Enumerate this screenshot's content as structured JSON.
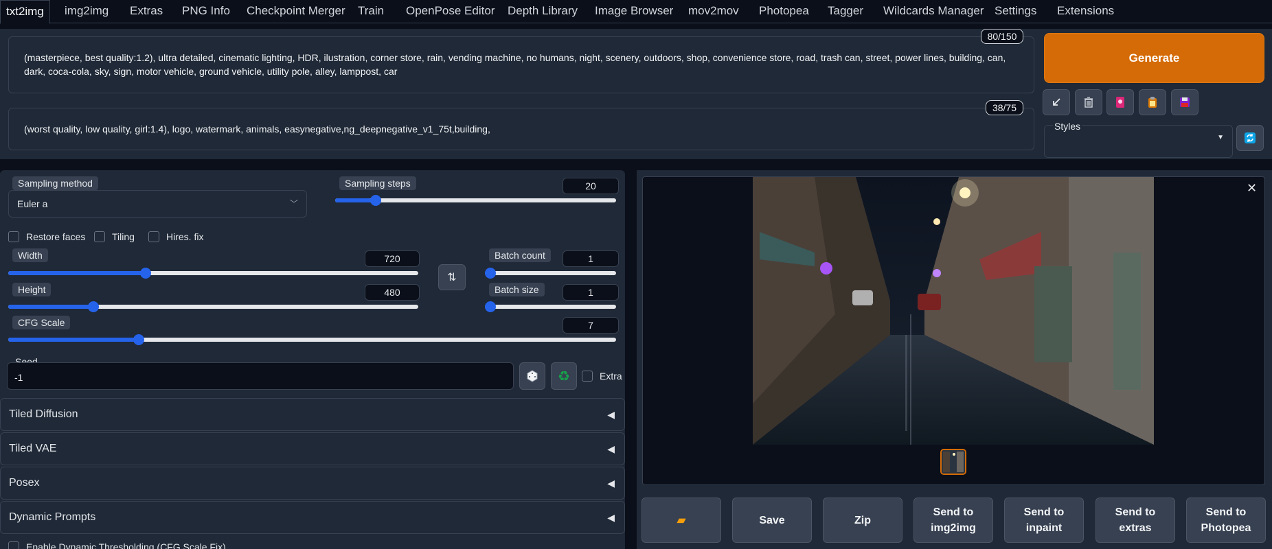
{
  "tabs": [
    "txt2img",
    "img2img",
    "Extras",
    "PNG Info",
    "Checkpoint Merger",
    "Train",
    "OpenPose Editor",
    "Depth Library",
    "Image Browser",
    "mov2mov",
    "Photopea",
    "Tagger",
    "Wildcards Manager",
    "Settings",
    "Extensions"
  ],
  "prompt": {
    "text": "(masterpiece, best quality:1.2), ultra detailed, cinematic lighting, HDR, ilustration, corner store, rain, vending machine, no humans, night, scenery, outdoors, shop, convenience store, road, trash can, street, power lines, building, can, dark, coca-cola, sky, sign, motor vehicle, ground vehicle, utility pole, alley, lamppost, car",
    "counter": "80/150"
  },
  "negative_prompt": {
    "text": "(worst quality, low quality, girl:1.4), logo, watermark, animals, easynegative,ng_deepnegative_v1_75t,building,",
    "counter": "38/75"
  },
  "generate_label": "Generate",
  "styles_label": "Styles",
  "sampling_method": {
    "label": "Sampling method",
    "value": "Euler a"
  },
  "sampling_steps": {
    "label": "Sampling steps",
    "value": "20",
    "fraction": 0.13
  },
  "checkboxes": {
    "restore_faces": "Restore faces",
    "tiling": "Tiling",
    "hires_fix": "Hires. fix"
  },
  "width": {
    "label": "Width",
    "value": "720",
    "fraction": 0.33
  },
  "height": {
    "label": "Height",
    "value": "480",
    "fraction": 0.2
  },
  "batch_count": {
    "label": "Batch count",
    "value": "1",
    "fraction": 0
  },
  "batch_size": {
    "label": "Batch size",
    "value": "1",
    "fraction": 0
  },
  "cfg_scale": {
    "label": "CFG Scale",
    "value": "7",
    "fraction": 0.21
  },
  "seed": {
    "label": "Seed",
    "value": "-1",
    "extra_label": "Extra"
  },
  "accordions": [
    "Tiled Diffusion",
    "Tiled VAE",
    "Posex",
    "Dynamic Prompts"
  ],
  "dynamic_thresholding_label": "Enable Dynamic Thresholding (CFG Scale Fix)",
  "actions": {
    "save": "Save",
    "zip": "Zip",
    "send_img2img": "Send to img2img",
    "send_inpaint": "Send to inpaint",
    "send_extras": "Send to extras",
    "send_photopea": "Send to Photopea"
  },
  "colors": {
    "accent": "#d56b06",
    "slider": "#2563eb",
    "background": "#0b0f19",
    "panel": "#1f2937"
  },
  "icons": {
    "paste": "arrow-icon",
    "trash": "trash-icon",
    "card": "card-icon",
    "clipboard": "clipboard-icon",
    "save": "floppy-icon",
    "refresh": "refresh-icon",
    "swap": "swap-icon",
    "dice": "dice-icon",
    "recycle": "recycle-icon",
    "folder": "folder-icon",
    "close": "close-icon"
  }
}
